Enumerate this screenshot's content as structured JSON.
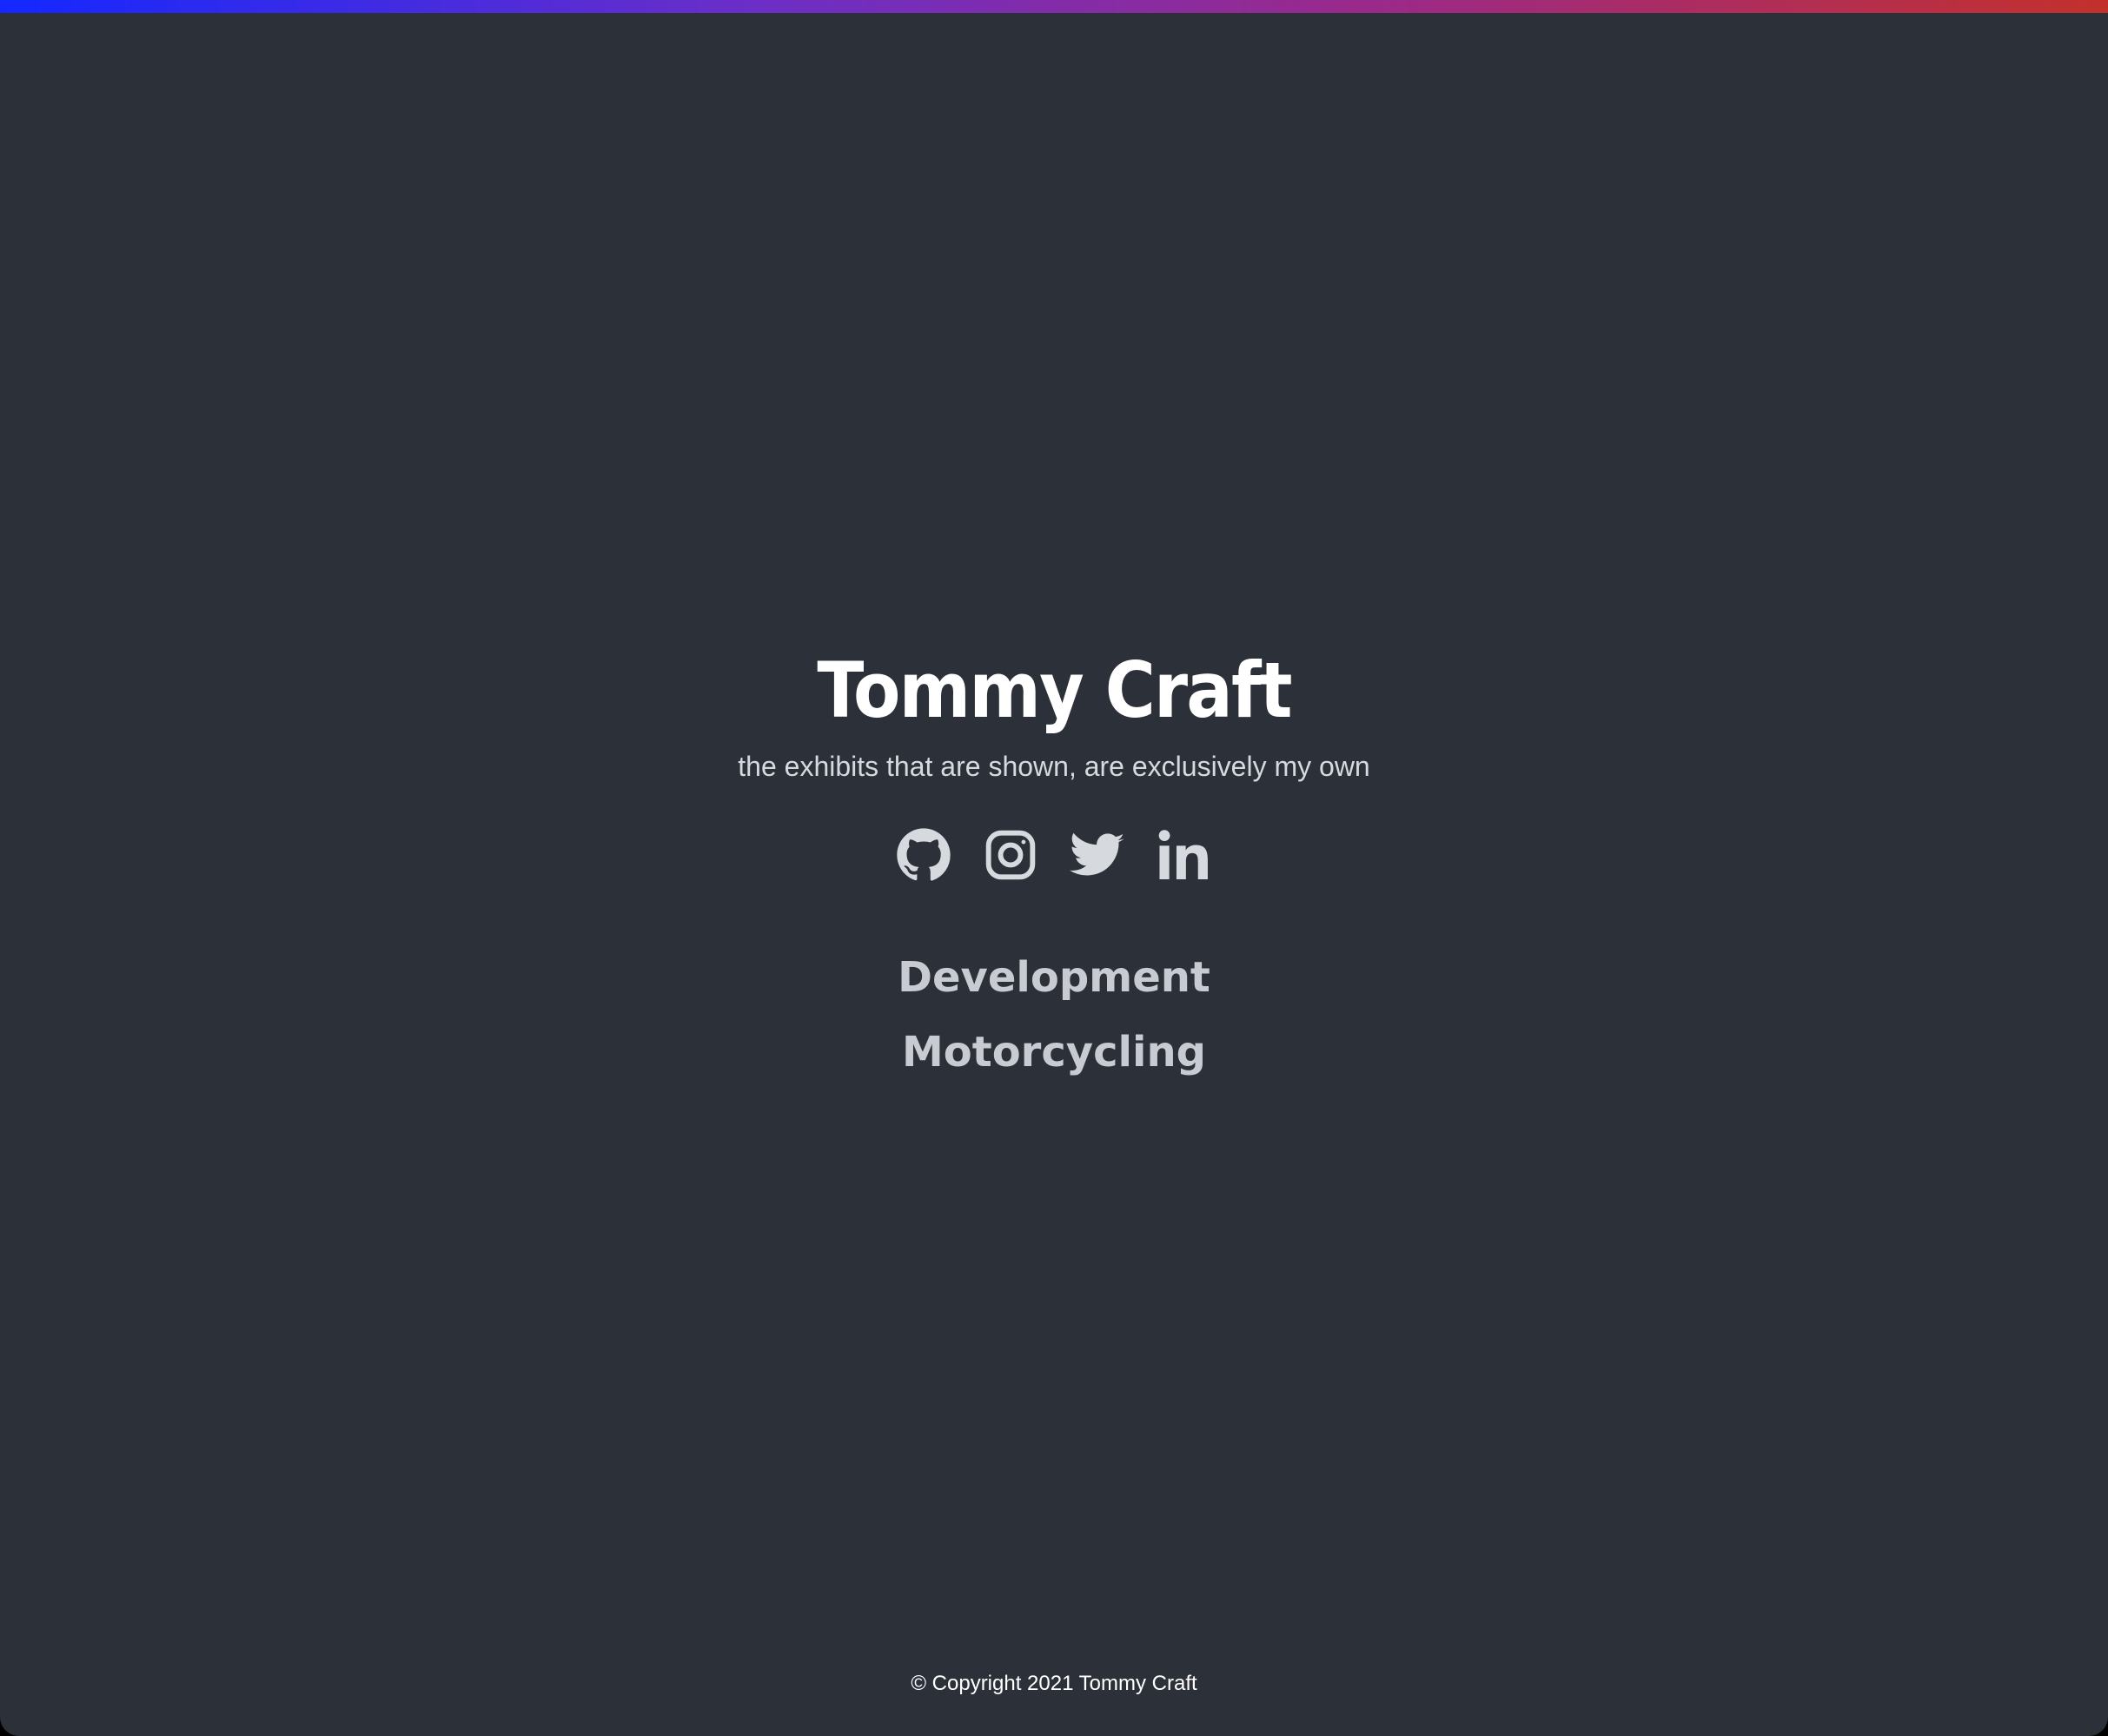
{
  "header": {
    "title": "Tommy Craft",
    "subtitle": "the exhibits that are shown, are exclusively my own"
  },
  "social": [
    {
      "icon": "github-icon"
    },
    {
      "icon": "instagram-icon"
    },
    {
      "icon": "twitter-icon"
    },
    {
      "icon": "linkedin-icon"
    }
  ],
  "nav": {
    "items": [
      {
        "label": "Development"
      },
      {
        "label": "Motorcycling"
      }
    ]
  },
  "footer": {
    "copyright": "© Copyright 2021 Tommy Craft"
  },
  "colors": {
    "background": "#2c3038",
    "accent_gradient": [
      "#1428ff",
      "#6a2ec8",
      "#9a2a8a",
      "#c3302c"
    ],
    "icon": "#d6d9de",
    "link": "#c8ccd2"
  }
}
